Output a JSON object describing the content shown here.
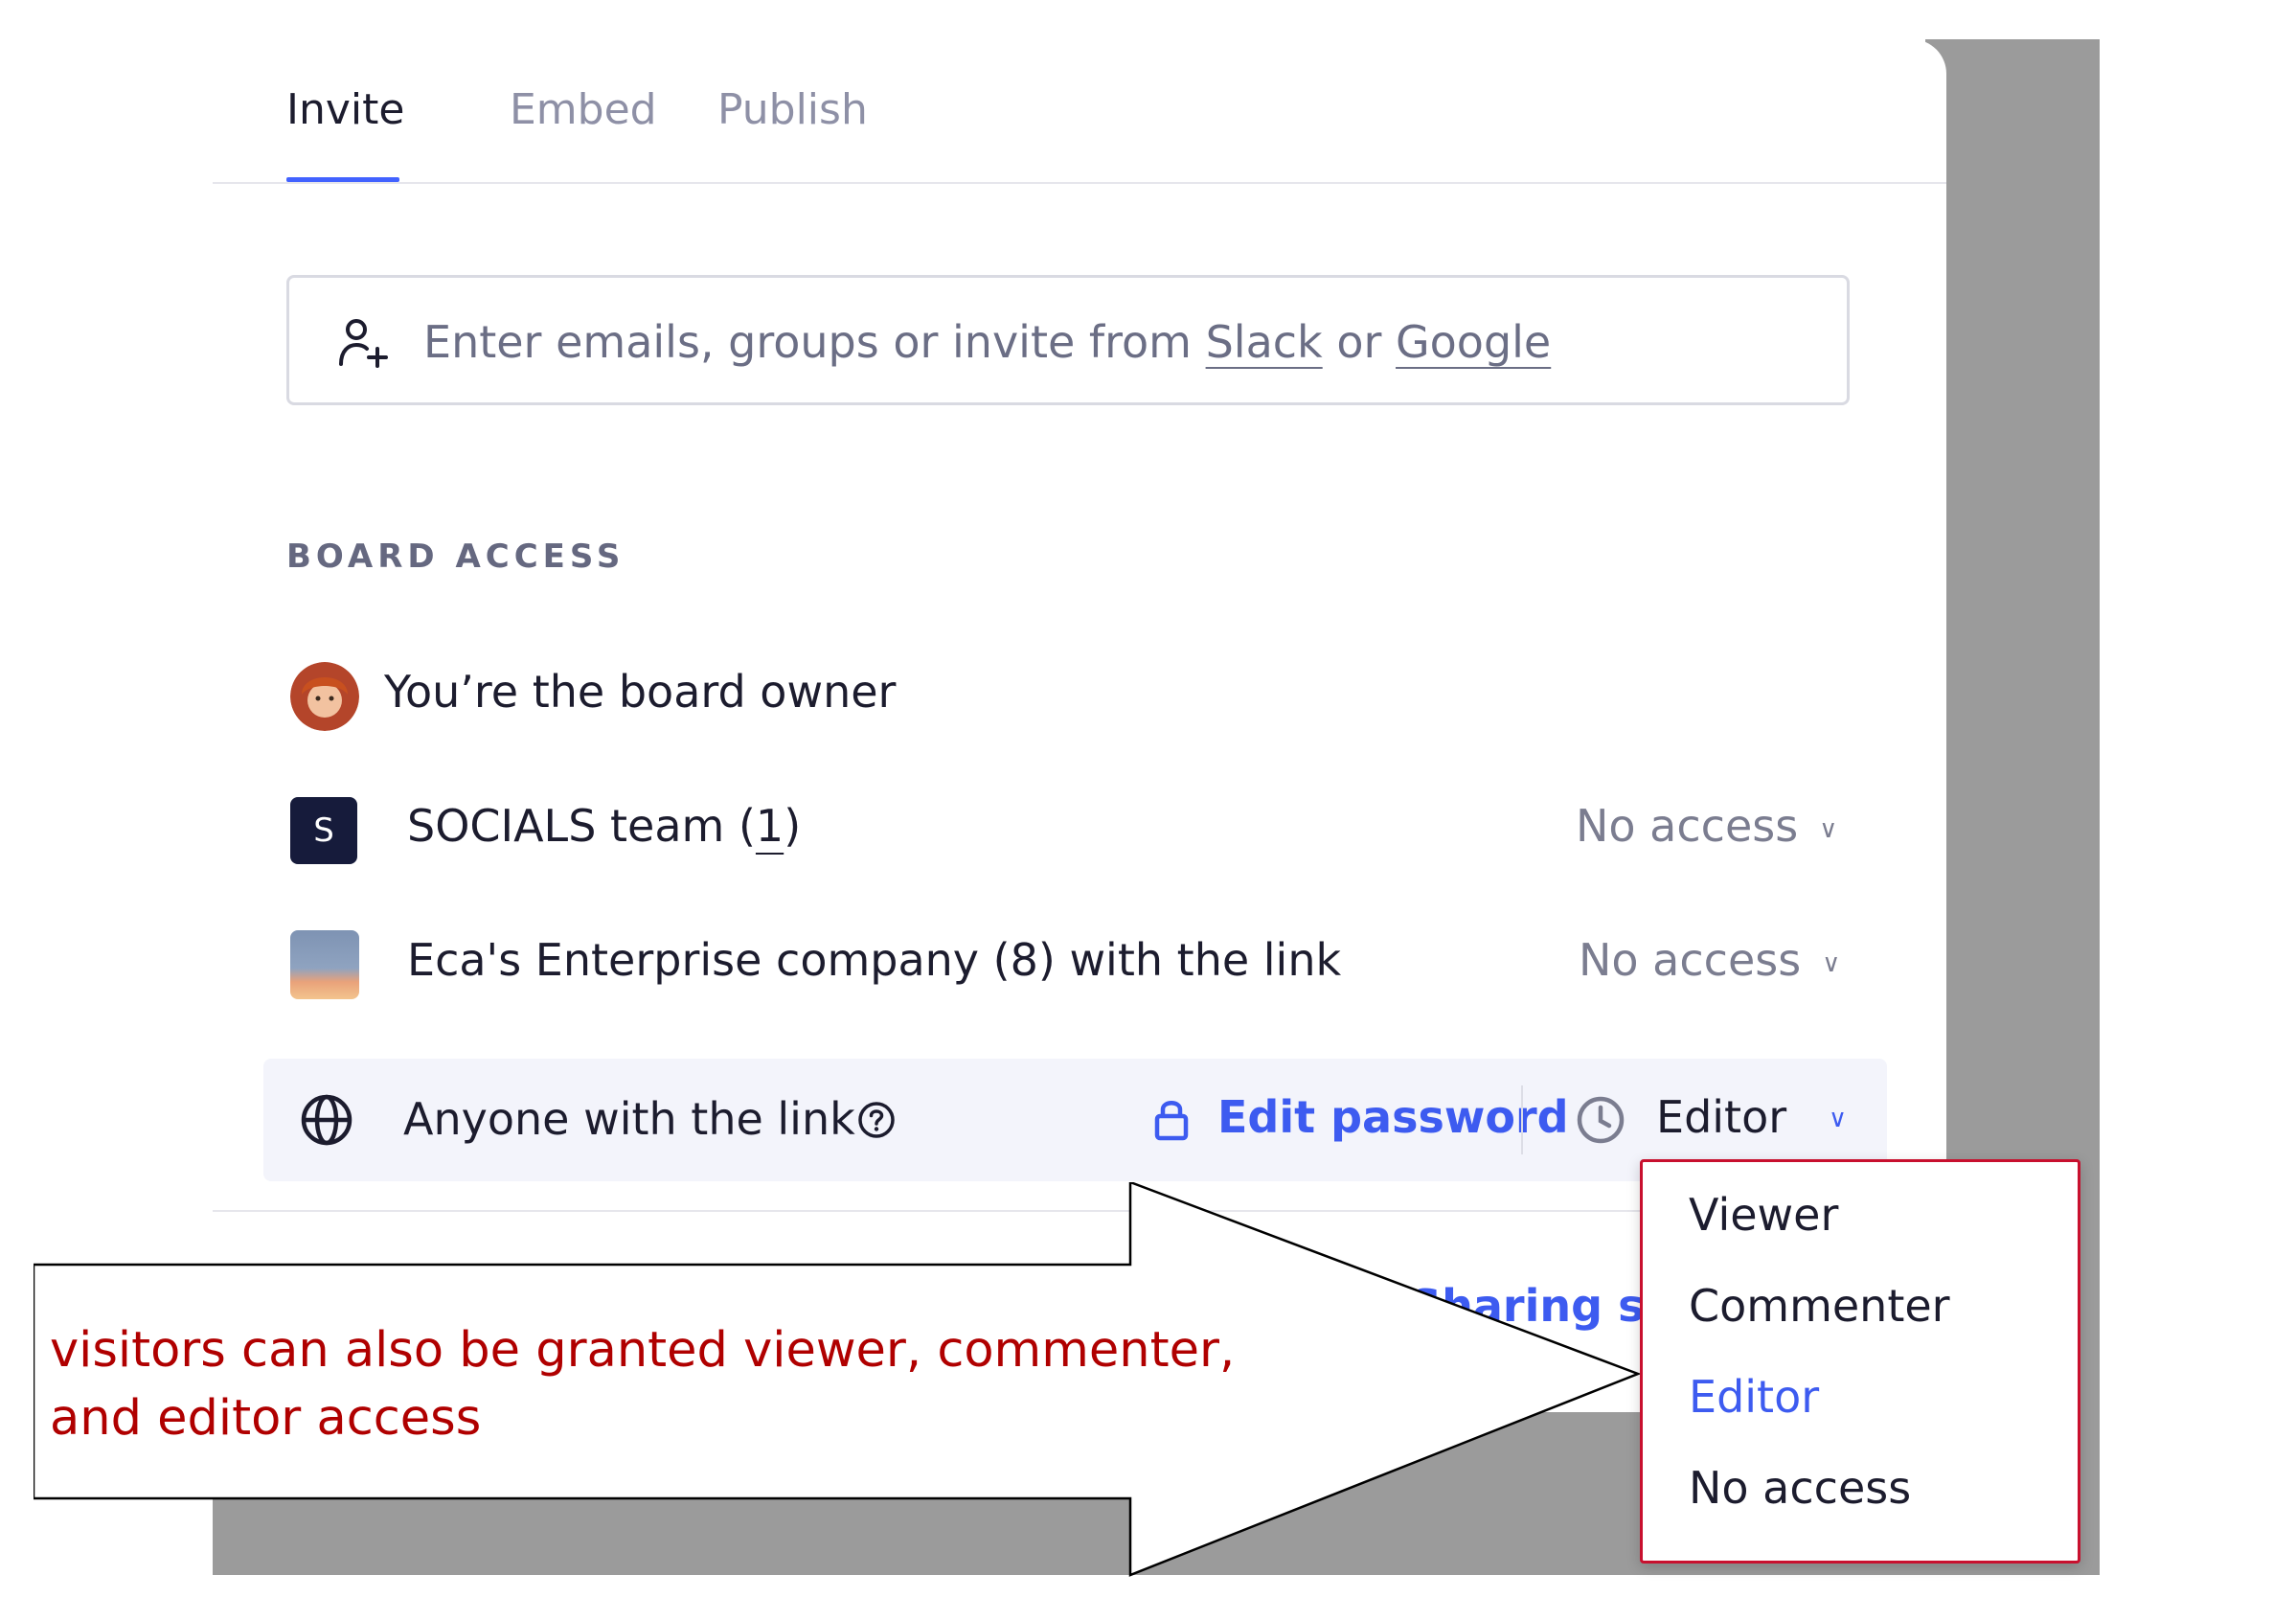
{
  "tabs": [
    {
      "label": "Invite",
      "active": true
    },
    {
      "label": "Embed",
      "active": false
    },
    {
      "label": "Publish",
      "active": false
    }
  ],
  "invite": {
    "placeholder_prefix": "Enter emails, groups or invite from ",
    "slack_label": "Slack",
    "or_label": " or ",
    "google_label": "Google",
    "icon": "add-user-icon"
  },
  "board_access": {
    "section_label": "BOARD ACCESS",
    "owner_text": "You’re the board owner",
    "team": {
      "initial": "S",
      "name": "SOCIALS team (",
      "count": "1",
      "close": ")",
      "access": "No access"
    },
    "company": {
      "name": "Eca's Enterprise company (8) with the link",
      "access": "No access"
    },
    "link": {
      "label": "Anyone with the link",
      "edit_password_label": "Edit password",
      "access": "Editor"
    }
  },
  "footer": {
    "sharing_settings_partial": "Sharing se"
  },
  "dropdown": {
    "options": [
      {
        "label": "Viewer",
        "selected": false
      },
      {
        "label": "Commenter",
        "selected": false
      },
      {
        "label": "Editor",
        "selected": true
      },
      {
        "label": "No access",
        "selected": false
      }
    ]
  },
  "callout": {
    "text": "visitors can also be granted viewer, commenter, and editor access"
  },
  "colors": {
    "accent": "#3d5bf0",
    "annotation": "#b00000",
    "dropdown_border": "#c8102e"
  }
}
